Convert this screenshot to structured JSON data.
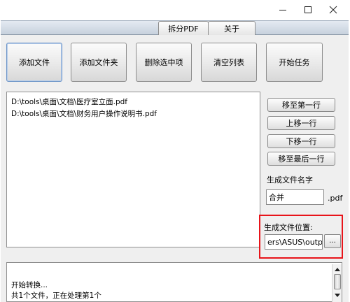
{
  "tabs": [
    {
      "label": "拆分PDF"
    },
    {
      "label": "关于"
    }
  ],
  "toolbar": {
    "add_file": "添加文件",
    "add_folder": "添加文件夹",
    "delete_selected": "删除选中项",
    "clear_list": "清空列表",
    "start_task": "开始任务"
  },
  "file_list": {
    "items": [
      "D:\\tools\\桌面\\文档\\医疗室立面.pdf",
      "D:\\tools\\桌面\\文档\\财务用户操作说明书.pdf"
    ]
  },
  "side": {
    "move_top": "移至第一行",
    "move_up": "上移一行",
    "move_down": "下移一行",
    "move_bottom": "移至最后一行",
    "output_name_label": "生成文件名字",
    "output_name_value": "合并",
    "extension": ".pdf",
    "output_location_label": "生成文件位置:",
    "output_location_value": "ers\\ASUS\\output",
    "browse_label": "..."
  },
  "log": {
    "lines": [
      "开始转换...",
      "共1个文件，正在处理第1个"
    ]
  },
  "colors": {
    "highlight_box": "#e8141a"
  }
}
